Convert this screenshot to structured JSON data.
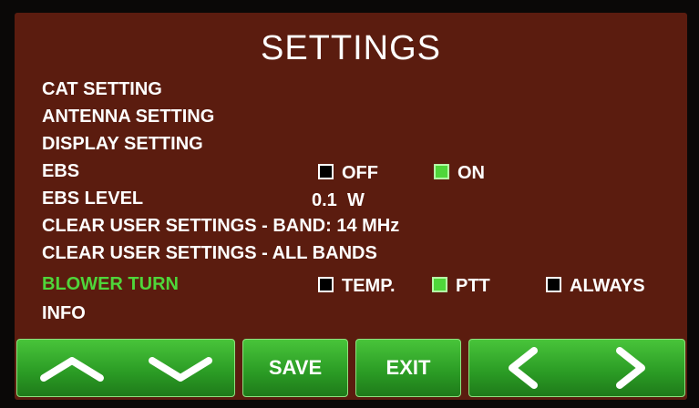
{
  "screen": {
    "title": "SETTINGS"
  },
  "menu": {
    "items": [
      {
        "label": "CAT SETTING"
      },
      {
        "label": "ANTENNA SETTING"
      },
      {
        "label": "DISPLAY SETTING"
      },
      {
        "label": "EBS"
      },
      {
        "label": "EBS LEVEL"
      },
      {
        "label": "CLEAR USER SETTINGS - BAND: 14 MHz"
      },
      {
        "label": "CLEAR USER SETTINGS - ALL BANDS"
      },
      {
        "label": "BLOWER TURN"
      },
      {
        "label": "INFO"
      }
    ],
    "active_item": "BLOWER TURN"
  },
  "ebs": {
    "off_label": "OFF",
    "off_checked": false,
    "on_label": "ON",
    "on_checked": true
  },
  "ebs_level": {
    "value": "0.1",
    "unit": "W"
  },
  "blower": {
    "temp_label": "TEMP.",
    "temp_checked": false,
    "ptt_label": "PTT",
    "ptt_checked": true,
    "always_label": "ALWAYS",
    "always_checked": false
  },
  "toolbar": {
    "up_icon": "chevron-up-icon",
    "down_icon": "chevron-down-icon",
    "save_label": "SAVE",
    "exit_label": "EXIT",
    "left_icon": "chevron-left-icon",
    "right_icon": "chevron-right-icon"
  },
  "colors": {
    "background": "#5b1c0f",
    "active_text": "#4fd63a",
    "button_green": "#2a9a24",
    "checkbox_on": "#4fd63a",
    "checkbox_off": "#000000"
  }
}
